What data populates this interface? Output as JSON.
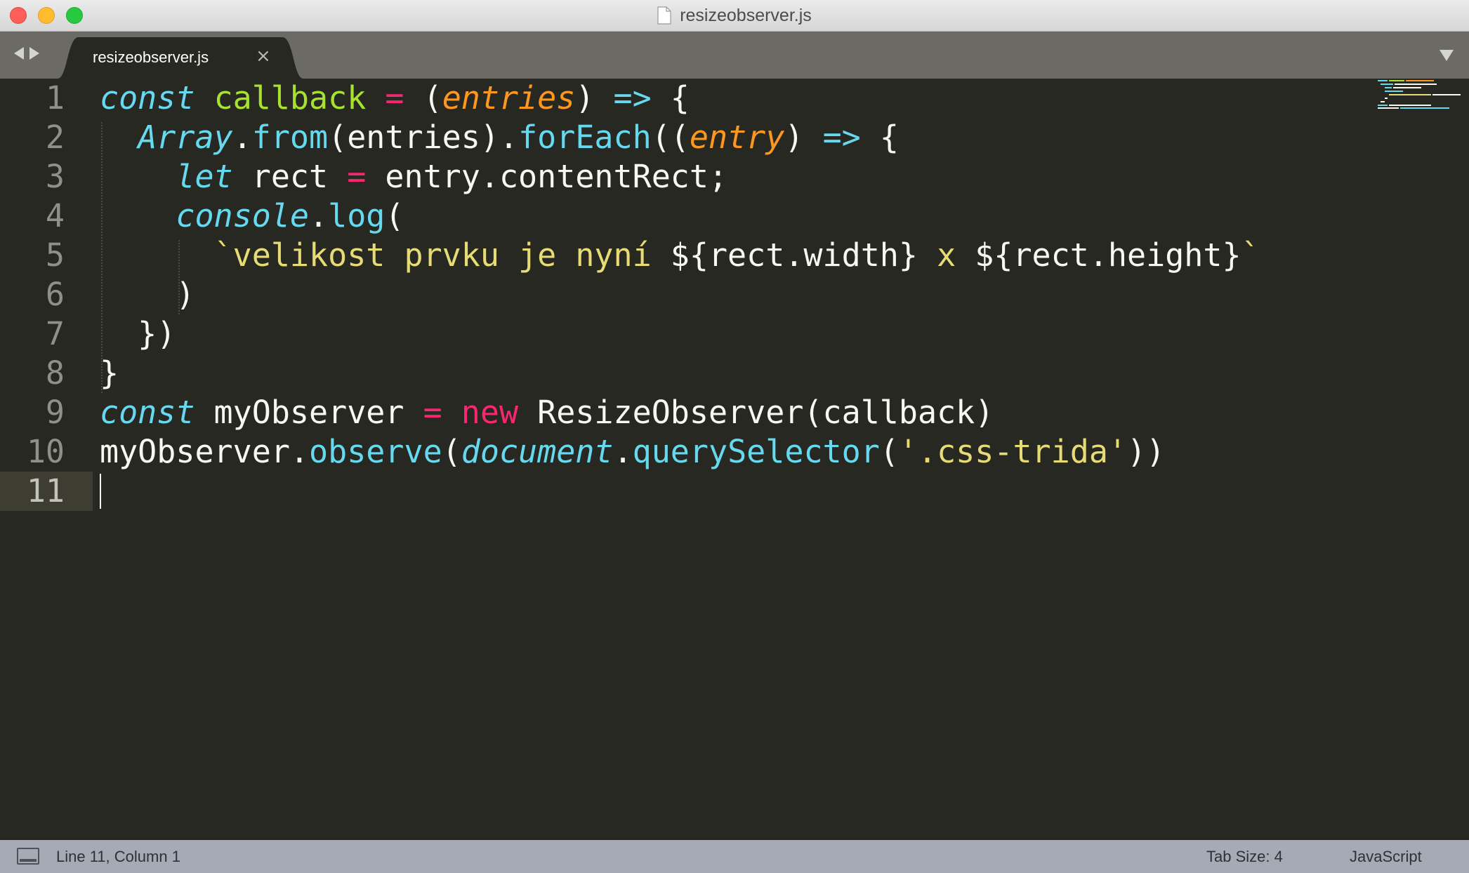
{
  "window": {
    "title": "resizeobserver.js"
  },
  "tabs": [
    {
      "label": "resizeobserver.js",
      "close_glyph": "×",
      "active": true
    }
  ],
  "editor": {
    "line_numbers": [
      "1",
      "2",
      "3",
      "4",
      "5",
      "6",
      "7",
      "8",
      "9",
      "10",
      "11"
    ],
    "active_line": "11",
    "language_theme": "Monokai",
    "lines": [
      [
        [
          "kw",
          "const"
        ],
        [
          "pl",
          " "
        ],
        [
          "fn",
          "callback"
        ],
        [
          "pl",
          " "
        ],
        [
          "op",
          "="
        ],
        [
          "pl",
          " ("
        ],
        [
          "arg",
          "entries"
        ],
        [
          "pl",
          ") "
        ],
        [
          "arw",
          "=>"
        ],
        [
          "pl",
          " {"
        ]
      ],
      [
        [
          "pl",
          "  "
        ],
        [
          "cls",
          "Array"
        ],
        [
          "pl",
          "."
        ],
        [
          "met",
          "from"
        ],
        [
          "pl",
          "(entries)."
        ],
        [
          "met",
          "forEach"
        ],
        [
          "pl",
          "(("
        ],
        [
          "arg",
          "entry"
        ],
        [
          "pl",
          ") "
        ],
        [
          "arw",
          "=>"
        ],
        [
          "pl",
          " {"
        ]
      ],
      [
        [
          "pl",
          "    "
        ],
        [
          "kw",
          "let"
        ],
        [
          "pl",
          " rect "
        ],
        [
          "op",
          "="
        ],
        [
          "pl",
          " entry.contentRect;"
        ]
      ],
      [
        [
          "pl",
          "    "
        ],
        [
          "cls",
          "console"
        ],
        [
          "pl",
          "."
        ],
        [
          "met",
          "log"
        ],
        [
          "pl",
          "("
        ]
      ],
      [
        [
          "pl",
          "      "
        ],
        [
          "str",
          "`velikost prvku je nyní "
        ],
        [
          "pl",
          "${rect.width}"
        ],
        [
          "str",
          " x "
        ],
        [
          "pl",
          "${rect.height}"
        ],
        [
          "str",
          "`"
        ]
      ],
      [
        [
          "pl",
          "    )"
        ]
      ],
      [
        [
          "pl",
          "  })"
        ]
      ],
      [
        [
          "pl",
          "}"
        ]
      ],
      [
        [
          "kw",
          "const"
        ],
        [
          "pl",
          " myObserver "
        ],
        [
          "op",
          "="
        ],
        [
          "pl",
          " "
        ],
        [
          "op",
          "new"
        ],
        [
          "pl",
          " ResizeObserver(callback)"
        ]
      ],
      [
        [
          "pl",
          "myObserver."
        ],
        [
          "met",
          "observe"
        ],
        [
          "pl",
          "("
        ],
        [
          "cls",
          "document"
        ],
        [
          "pl",
          "."
        ],
        [
          "met",
          "querySelector"
        ],
        [
          "pl",
          "("
        ],
        [
          "str",
          "'.css-trida'"
        ],
        [
          "pl",
          "))"
        ]
      ],
      []
    ]
  },
  "statusbar": {
    "position": "Line 11, Column 1",
    "tab_size": "Tab Size: 4",
    "syntax": "JavaScript"
  },
  "colors": {
    "background": "#272822",
    "keyword": "#66d9ef",
    "function_name": "#a6e22e",
    "operator": "#f92672",
    "parameter": "#fd971f",
    "string": "#e6db74",
    "plain": "#f8f8f2",
    "status_bar": "#a4abb5",
    "tab_bar": "#6b6b64"
  },
  "icons": {
    "close": "close-button",
    "minimize": "minimize-button",
    "maximize": "zoom-button",
    "file": "file-icon",
    "nav_back": "arrow-left-icon",
    "nav_forward": "arrow-right-icon",
    "tab_menu": "chevron-down-icon",
    "panel_toggle": "panel-toggle-icon"
  }
}
